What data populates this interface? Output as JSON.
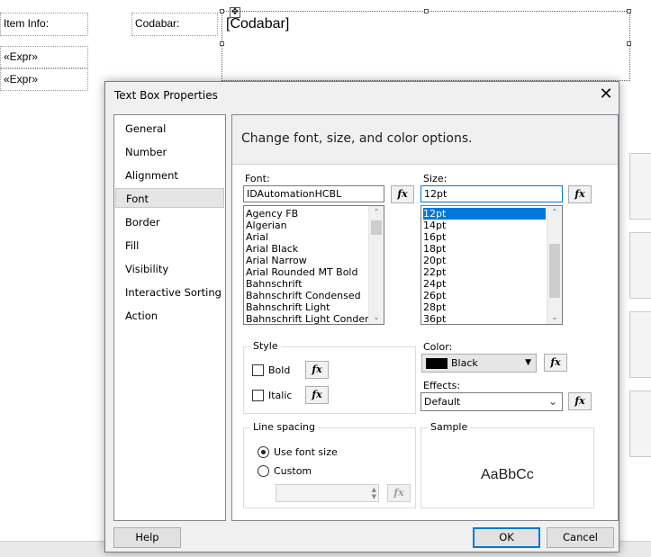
{
  "designer": {
    "item_info_label": "Item Info:",
    "codabar_label": "Codabar:",
    "codabar_value": "[Codabar]",
    "expr1": "«Expr»",
    "expr2": "«Expr»"
  },
  "dialog": {
    "title": "Text Box Properties",
    "close_icon": "close-icon",
    "nav": [
      "General",
      "Number",
      "Alignment",
      "Font",
      "Border",
      "Fill",
      "Visibility",
      "Interactive Sorting",
      "Action"
    ],
    "selected_nav": "Font",
    "header": "Change font, size, and color options.",
    "font": {
      "label": "Font:",
      "value": "IDAutomationHCBL",
      "list": [
        "Agency FB",
        "Algerian",
        "Arial",
        "Arial Black",
        "Arial Narrow",
        "Arial Rounded MT Bold",
        "Bahnschrift",
        "Bahnschrift Condensed",
        "Bahnschrift Light",
        "Bahnschrift Light Condens"
      ]
    },
    "size": {
      "label": "Size:",
      "value": "12pt",
      "list": [
        "12pt",
        "14pt",
        "16pt",
        "18pt",
        "20pt",
        "22pt",
        "24pt",
        "26pt",
        "28pt",
        "36pt"
      ],
      "selected": "12pt"
    },
    "fx": "fx",
    "style": {
      "title": "Style",
      "bold": "Bold",
      "italic": "Italic"
    },
    "color": {
      "label": "Color:",
      "value": "Black",
      "swatch": "#000000"
    },
    "effects": {
      "label": "Effects:",
      "value": "Default"
    },
    "line_spacing": {
      "title": "Line spacing",
      "use_font_size": "Use font size",
      "custom": "Custom"
    },
    "sample": {
      "title": "Sample",
      "text": "AaBbCc"
    },
    "buttons": {
      "help": "Help",
      "ok": "OK",
      "cancel": "Cancel"
    }
  }
}
